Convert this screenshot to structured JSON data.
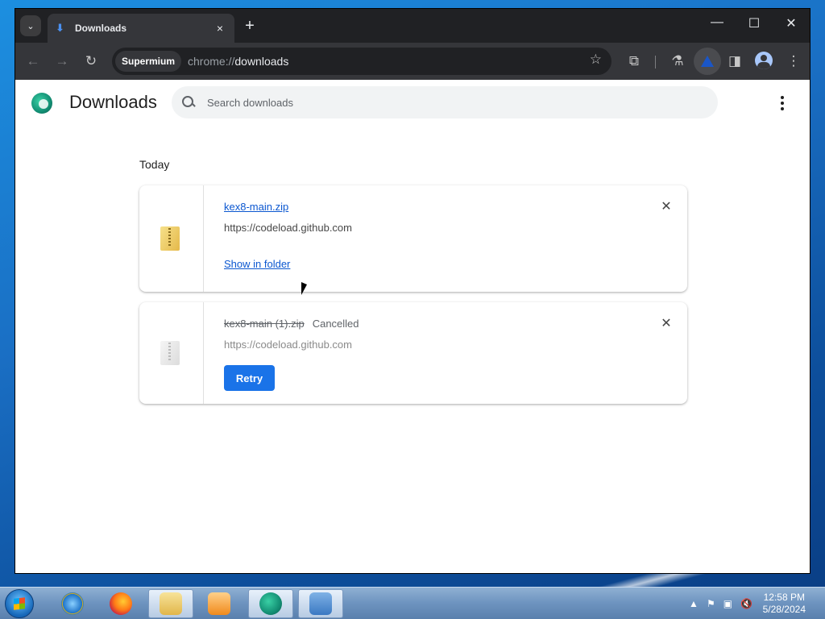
{
  "browser": {
    "tab": {
      "title": "Downloads",
      "close_icon": "×"
    },
    "new_tab_icon": "+",
    "tab_search_icon": "⌄",
    "window_controls": {
      "minimize": "—",
      "maximize": "☐",
      "close": "✕"
    },
    "toolbar": {
      "back": "←",
      "forward": "→",
      "reload": "↻",
      "chip": "Supermium",
      "url_scheme": "chrome://",
      "url_host": "downloads",
      "bookmark": "☆",
      "extensions": "⧉",
      "labs": "⚗",
      "side_panel": "◨",
      "menu": "⋮"
    }
  },
  "page": {
    "title": "Downloads",
    "search": {
      "placeholder": "Search downloads"
    },
    "section_label": "Today",
    "items": [
      {
        "filename": "kex8-main.zip",
        "url": "https://codeload.github.com",
        "action": "Show in folder",
        "remove_icon": "✕"
      },
      {
        "filename": "kex8-main (1).zip",
        "status": "Cancelled",
        "url": "https://codeload.github.com",
        "action": "Retry",
        "remove_icon": "✕"
      }
    ]
  },
  "taskbar": {
    "tray_icons": [
      "▲",
      "⚑",
      "▣",
      "🔇"
    ],
    "time": "12:58 PM",
    "date": "5/28/2024"
  },
  "colors": {
    "accent": "#1a73e8",
    "link": "#0b57d0",
    "frame": "#202124",
    "toolbar": "#35363a"
  }
}
